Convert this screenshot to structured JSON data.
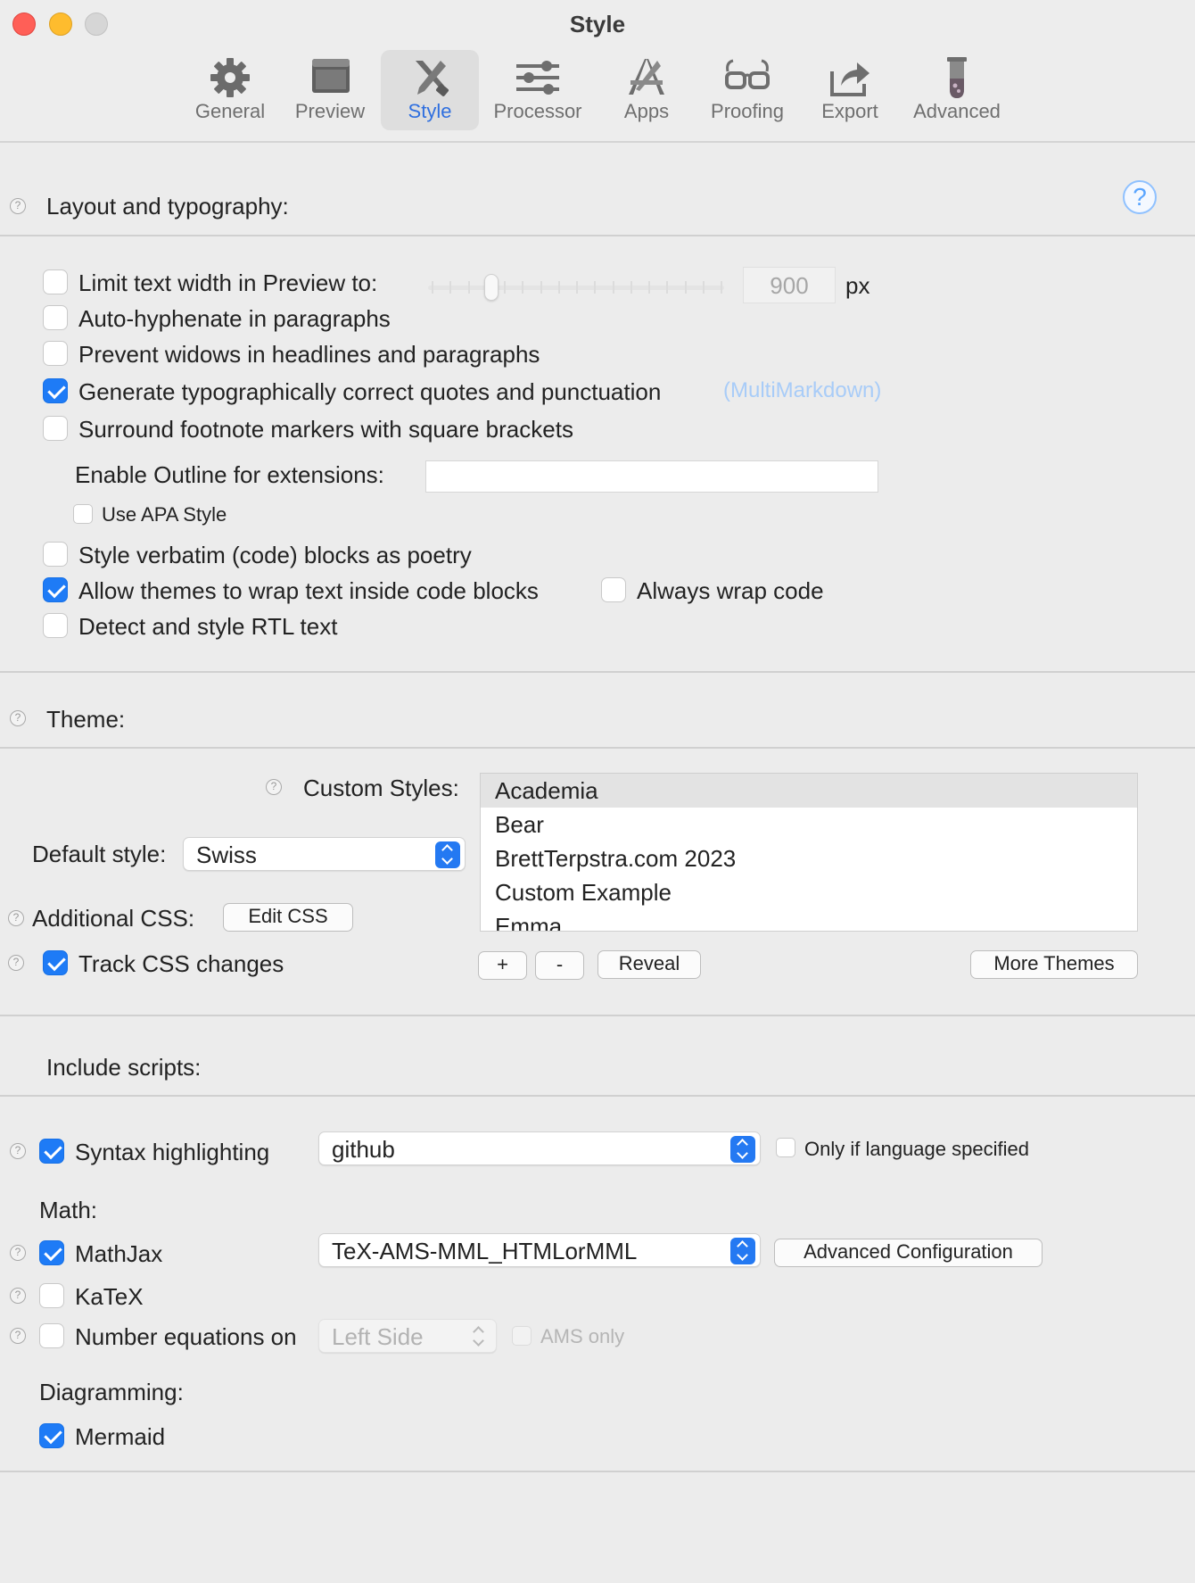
{
  "window": {
    "title": "Style"
  },
  "tabs": [
    {
      "label": "General",
      "icon": "gear-icon"
    },
    {
      "label": "Preview",
      "icon": "preview-window-icon"
    },
    {
      "label": "Style",
      "icon": "style-tools-icon",
      "active": true
    },
    {
      "label": "Processor",
      "icon": "sliders-icon"
    },
    {
      "label": "Apps",
      "icon": "apps-icon"
    },
    {
      "label": "Proofing",
      "icon": "glasses-icon"
    },
    {
      "label": "Export",
      "icon": "export-icon"
    },
    {
      "label": "Advanced",
      "icon": "test-tube-icon"
    }
  ],
  "layout_section": {
    "title": "Layout and typography:",
    "help_big": "?",
    "limit_width": {
      "label": "Limit text width in Preview to:",
      "checked": false,
      "value": "900",
      "unit": "px",
      "slider_fraction": 0.2
    },
    "auto_hyphenate": {
      "label": "Auto-hyphenate in paragraphs",
      "checked": false
    },
    "prevent_widows": {
      "label": "Prevent widows in headlines and paragraphs",
      "checked": false
    },
    "typographic_quotes": {
      "label": "Generate typographically correct quotes and punctuation",
      "checked": true,
      "note": "(MultiMarkdown)"
    },
    "footnote_brackets": {
      "label": "Surround footnote markers with square brackets",
      "checked": false
    },
    "outline_extensions": {
      "label": "Enable Outline for extensions:",
      "value": ""
    },
    "apa_style": {
      "label": "Use APA Style",
      "checked": false
    },
    "verbatim_poetry": {
      "label": "Style verbatim (code) blocks as poetry",
      "checked": false
    },
    "wrap_code_blocks": {
      "label": "Allow themes to wrap text inside code blocks",
      "checked": true
    },
    "always_wrap": {
      "label": "Always wrap code",
      "checked": false
    },
    "rtl_text": {
      "label": "Detect and style RTL text",
      "checked": false
    }
  },
  "theme_section": {
    "title": "Theme:",
    "custom_styles_label": "Custom Styles:",
    "custom_styles": [
      "Academia",
      "Bear",
      "BrettTerpstra.com 2023",
      "Custom Example",
      "Emma"
    ],
    "selected_style": "Academia",
    "default_style_label": "Default style:",
    "default_style_value": "Swiss",
    "additional_css_label": "Additional CSS:",
    "edit_css_label": "Edit CSS",
    "track_css": {
      "label": "Track CSS changes",
      "checked": true
    },
    "add_label": "+",
    "remove_label": "-",
    "reveal_label": "Reveal",
    "more_themes_label": "More Themes"
  },
  "scripts_section": {
    "title": "Include scripts:",
    "syntax": {
      "label": "Syntax highlighting",
      "checked": true,
      "theme": "github"
    },
    "only_language": {
      "label": "Only if language specified",
      "checked": false
    },
    "math_label": "Math:",
    "mathjax": {
      "label": "MathJax",
      "checked": true,
      "config": "TeX-AMS-MML_HTMLorMML"
    },
    "advanced_config_label": "Advanced Configuration",
    "katex": {
      "label": "KaTeX",
      "checked": false
    },
    "number_equations": {
      "label": "Number equations on",
      "checked": false,
      "side": "Left Side"
    },
    "ams_only": {
      "label": "AMS only",
      "checked": false
    },
    "diagramming_label": "Diagramming:",
    "mermaid": {
      "label": "Mermaid",
      "checked": true
    }
  },
  "colors": {
    "accent": "#1e7bf6",
    "active_tab": "#2f6fdf"
  }
}
